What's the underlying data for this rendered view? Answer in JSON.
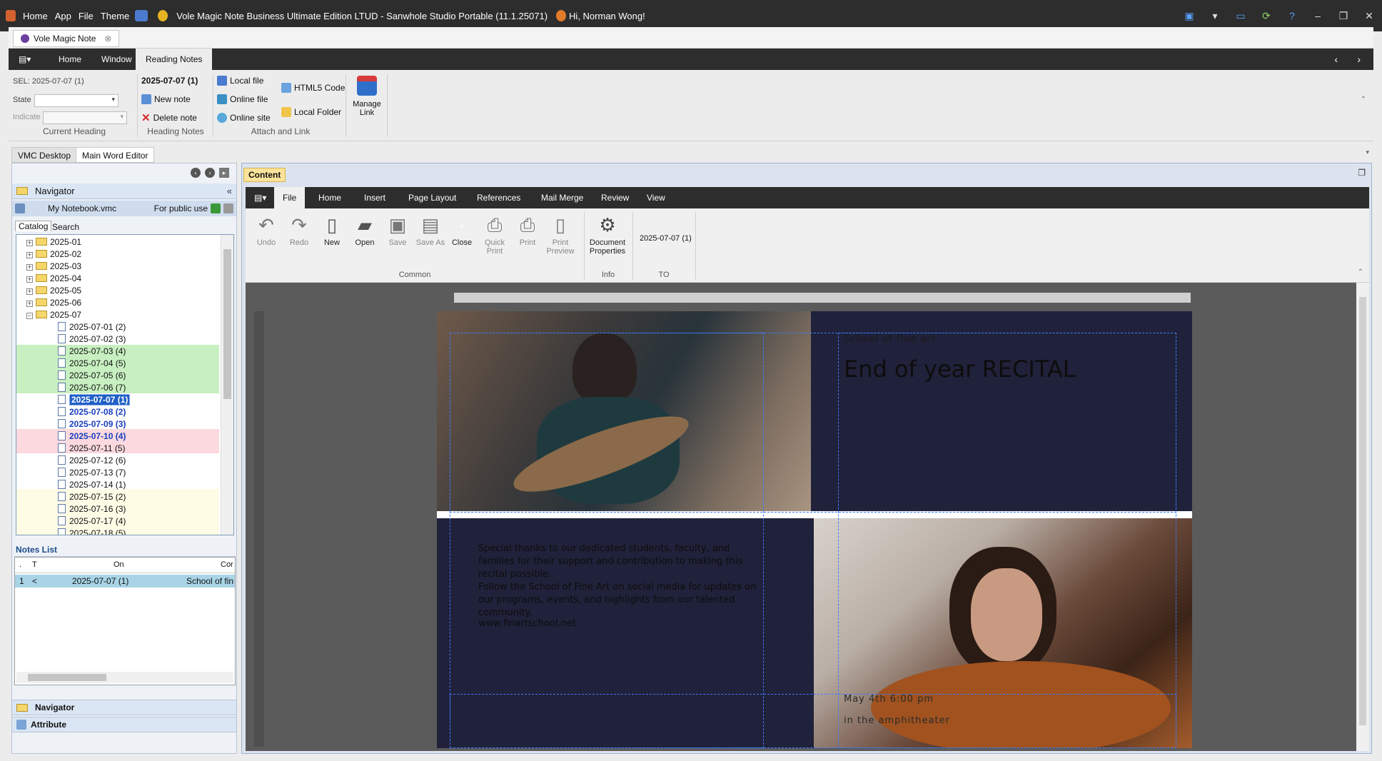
{
  "titlebar": {
    "menu": [
      "Home",
      "App",
      "File",
      "Theme"
    ],
    "title": "Vole Magic Note Business Ultimate Edition LTUD - Sanwhole Studio Portable (11.1.25071)",
    "greeting": "Hi, Norman Wong!"
  },
  "doc_tab": {
    "label": "Vole Magic Note"
  },
  "ribbon_tabs": [
    "Home",
    "Window",
    "Reading Notes"
  ],
  "ribbon": {
    "sel": "SEL: 2025-07-07 (1)",
    "state_label": "State",
    "indicate_label": "Indicate",
    "current_heading_label": "Current Heading",
    "heading_title": "2025-07-07 (1)",
    "new_note": "New note",
    "delete_note": "Delete note",
    "heading_notes_label": "Heading Notes",
    "local_file": "Local file",
    "online_file": "Online file",
    "online_site": "Online site",
    "html5_code": "HTML5 Code",
    "local_folder": "Local Folder",
    "manage_link_1": "Manage",
    "manage_link_2": "Link",
    "attach_label": "Attach and Link"
  },
  "view_tabs": [
    "VMC Desktop",
    "Main Word Editor"
  ],
  "navigator": {
    "title": "Navigator",
    "notebook": "My Notebook.vmc",
    "public": "For public use",
    "tabs": [
      "Catalog",
      "Search"
    ],
    "months": [
      "2025-01",
      "2025-02",
      "2025-03",
      "2025-04",
      "2025-05",
      "2025-06",
      "2025-07"
    ],
    "days": [
      "2025-07-01 (2)",
      "2025-07-02 (3)",
      "2025-07-03 (4)",
      "2025-07-04 (5)",
      "2025-07-05 (6)",
      "2025-07-06 (7)",
      "2025-07-07 (1)",
      "2025-07-08 (2)",
      "2025-07-09 (3)",
      "2025-07-10 (4)",
      "2025-07-11 (5)",
      "2025-07-12 (6)",
      "2025-07-13 (7)",
      "2025-07-14 (1)",
      "2025-07-15 (2)",
      "2025-07-16 (3)",
      "2025-07-17 (4)",
      "2025-07-18 (5)"
    ]
  },
  "notes_list": {
    "title": "Notes List",
    "headers": [
      ".",
      "T",
      "On",
      "Cor"
    ],
    "row": [
      "1",
      "<",
      "2025-07-07 (1)",
      "School of fin"
    ]
  },
  "bottom_panels": [
    "Navigator",
    "Attribute"
  ],
  "content_tab": "Content",
  "editor_tabs": [
    "File",
    "Home",
    "Insert",
    "Page Layout",
    "References",
    "Mail Merge",
    "Review",
    "View"
  ],
  "editor_tools": {
    "undo": "Undo",
    "redo": "Redo",
    "new": "New",
    "open": "Open",
    "save": "Save",
    "save_as": "Save As",
    "close": "Close",
    "quick_print_1": "Quick",
    "quick_print_2": "Print",
    "print": "Print",
    "print_preview_1": "Print",
    "print_preview_2": "Preview",
    "doc_props_1": "Document",
    "doc_props_2": "Properties",
    "to_value": "2025-07-07 (1)",
    "common_label": "Common",
    "info_label": "Info",
    "to_label": "TO"
  },
  "document": {
    "school": "School of fine art",
    "headline": "End of year RECITAL",
    "para1": "Special thanks to our dedicated students, faculty, and families for their support and contribution to making this recital possible.",
    "para2": "Follow the School of Fine Art on social media for updates on our programs, events, and highlights from our talented community.",
    "website": "www.finartschool.net",
    "date": "May 4th 6:00 pm",
    "venue": "in the amphitheater"
  }
}
